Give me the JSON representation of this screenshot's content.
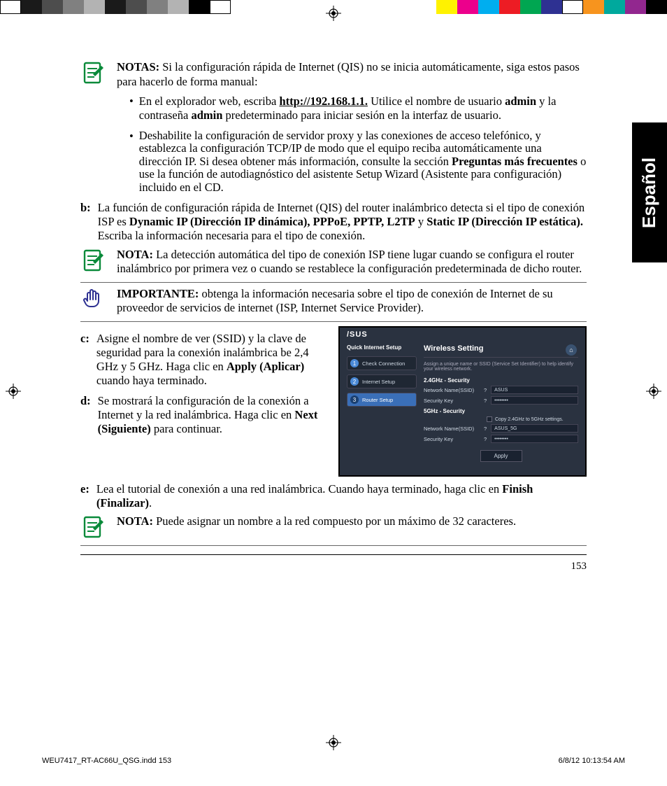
{
  "colorbar_left": [
    "#ffffff",
    "#fff200",
    "#00ffff",
    "#00a651",
    "#ec008c",
    "#ed1c24",
    "#2e3192",
    "#000000",
    "#404040",
    "#666666",
    "#999999",
    "#cccccc"
  ],
  "colorbar_right": [
    "#404040",
    "#fff200",
    "#ec008c",
    "#00aeef",
    "#ed1c24",
    "#00a651",
    "#2e3192",
    "#f7941e",
    "#00a99d",
    "#92278f",
    "#ffffff",
    "#ffffff"
  ],
  "lang_tab": "Español",
  "notas_label": "NOTAS:",
  "notas_text": "Si la configuración rápida de Internet (QIS) no se inicia automáticamente, siga estos pasos para hacerlo de forma manual:",
  "bullet1_pre": "En el explorador web, escriba ",
  "bullet1_url": "http://192.168.1.1.",
  "bullet1_mid1": " Utilice el nombre de usuario ",
  "bullet1_admin1": "admin",
  "bullet1_mid2": " y la contraseña ",
  "bullet1_admin2": "admin",
  "bullet1_post": " predeterminado para iniciar sesión en la interfaz de usuario.",
  "bullet2_pre": "Deshabilite la configuración de servidor proxy y las conexiones de acceso telefónico, y establezca la configuración TCP/IP de modo que el equipo reciba automáticamente una dirección IP. Si desea obtener más información, consulte la sección ",
  "bullet2_bold": "Preguntas más frecuentes",
  "bullet2_post": " o use la función de autodiagnóstico del asistente Setup Wizard (Asistente para configuración) incluido en el CD.",
  "step_b_label": "b:",
  "step_b_pre": "La función de configuración rápida de Internet (QIS) del router inalámbrico detecta si el tipo de conexión ISP es ",
  "step_b_bold": "Dynamic IP (Dirección IP dinámica), PPPoE, PPTP, L2TP",
  "step_b_mid": " y ",
  "step_b_bold2": "Static IP (Dirección IP estática).",
  "step_b_post": " Escriba la información necesaria para el tipo de conexión.",
  "nota2_label": "NOTA:",
  "nota2_text": "La detección automática del tipo de conexión ISP tiene lugar cuando se configura el router inalámbrico por primera vez o cuando se restablece la configuración predeterminada de dicho router.",
  "importante_label": "IMPORTANTE:",
  "importante_text": "obtenga la información necesaria sobre el tipo de conexión de Internet de su proveedor de servicios de internet (ISP, Internet Service Provider).",
  "step_c_label": "c:",
  "step_c_pre": "Asigne el nombre de ver (SSID) y la clave de seguridad para la conexión inalámbrica be 2,4 GHz y 5 GHz. Haga clic en ",
  "step_c_bold": "Apply (Aplicar)",
  "step_c_post": " cuando haya terminado.",
  "step_d_label": "d:",
  "step_d_pre": "Se mostrará la configuración de la conexión a Internet y la red inalámbrica. Haga clic en ",
  "step_d_bold": "Next (Siguiente)",
  "step_d_post": " para continuar.",
  "step_e_label": "e:",
  "step_e_pre": "Lea el tutorial de conexión a una red inalámbrica. Cuando haya terminado, haga clic en ",
  "step_e_bold": "Finish (Finalizar)",
  "step_e_post": ".",
  "nota3_label": "NOTA:",
  "nota3_text": "Puede asignar un nombre a la red compuesto por un máximo de 32 caracteres.",
  "page_num": "153",
  "footer_left": "WEU7417_RT-AC66U_QSG.indd   153",
  "footer_right": "6/8/12   10:13:54 AM",
  "shot": {
    "logo": "/SUS",
    "side_title": "Quick Internet Setup",
    "side1": "Check Connection",
    "side2": "Internet Setup",
    "side3": "Router Setup",
    "title": "Wireless Setting",
    "desc": "Assign a unique name or SSID (Service Set Identifier) to help identify your wireless network.",
    "sec24": "2.4GHz - Security",
    "sec5": "5GHz - Security",
    "lbl_name": "Network Name(SSID)",
    "lbl_key": "Security Key",
    "val_name24": "ASUS",
    "val_key": "••••••••",
    "val_name5": "ASUS_5G",
    "copy": "Copy 2.4GHz to 5GHz settings.",
    "apply": "Apply"
  }
}
